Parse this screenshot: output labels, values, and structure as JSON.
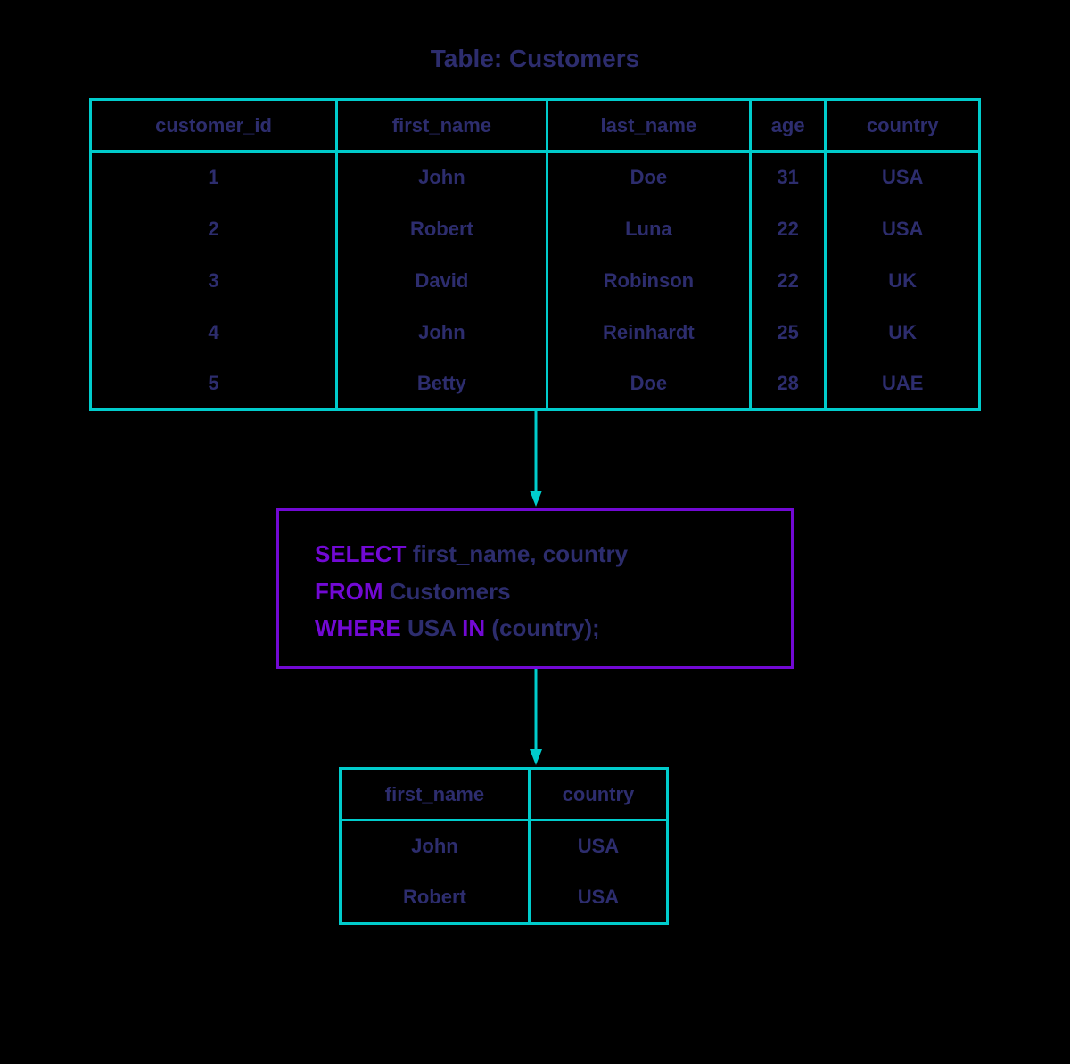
{
  "title": "Table: Customers",
  "source": {
    "headers": [
      "customer_id",
      "first_name",
      "last_name",
      "age",
      "country"
    ],
    "rows": [
      {
        "customer_id": "1",
        "first_name": "John",
        "last_name": "Doe",
        "age": "31",
        "country": "USA"
      },
      {
        "customer_id": "2",
        "first_name": "Robert",
        "last_name": "Luna",
        "age": "22",
        "country": "USA"
      },
      {
        "customer_id": "3",
        "first_name": "David",
        "last_name": "Robinson",
        "age": "22",
        "country": "UK"
      },
      {
        "customer_id": "4",
        "first_name": "John",
        "last_name": "Reinhardt",
        "age": "25",
        "country": "UK"
      },
      {
        "customer_id": "5",
        "first_name": "Betty",
        "last_name": "Doe",
        "age": "28",
        "country": "UAE"
      }
    ]
  },
  "sql": {
    "kw_select": "SELECT",
    "select_cols": " first_name, country",
    "kw_from": "FROM",
    "from_tbl": " Customers",
    "kw_where": "WHERE",
    "where_pre": " USA ",
    "kw_in": "IN",
    "where_post": " (country);"
  },
  "result": {
    "headers": [
      "first_name",
      "country"
    ],
    "rows": [
      {
        "first_name": "John",
        "country": "USA"
      },
      {
        "first_name": "Robert",
        "country": "USA"
      }
    ]
  },
  "colors": {
    "table_border": "#00cccc",
    "sql_border": "#7209d4",
    "text": "#2d2d6e"
  }
}
